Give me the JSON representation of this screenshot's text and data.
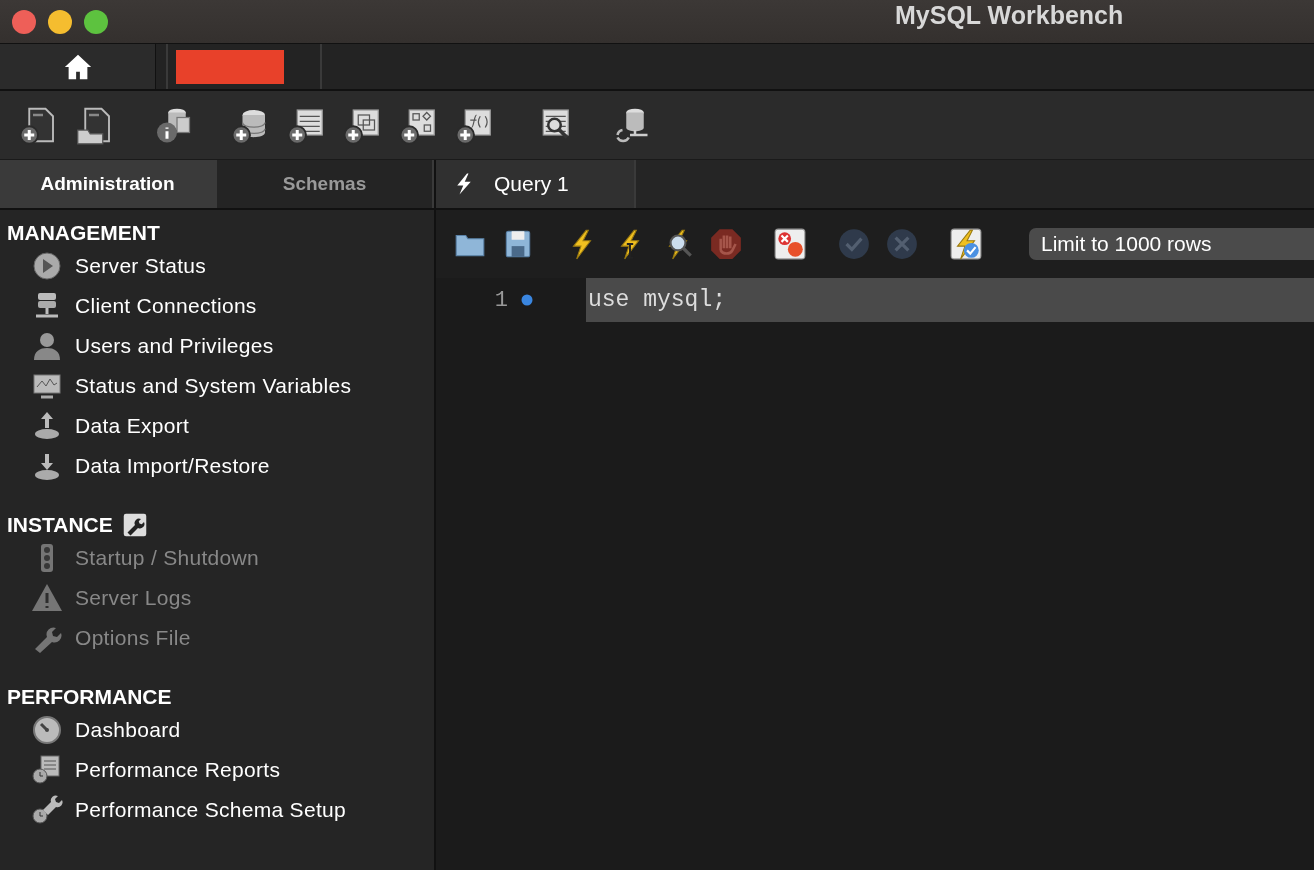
{
  "window": {
    "title": "MySQL Workbench"
  },
  "connection_tabs": [
    {
      "kind": "home"
    },
    {
      "kind": "connection"
    }
  ],
  "toolbar": {
    "groups": [
      [
        {
          "kind": "new-sql"
        },
        {
          "kind": "open-sql"
        }
      ],
      [
        {
          "kind": "inspect"
        }
      ],
      [
        {
          "kind": "new-schema"
        },
        {
          "kind": "new-table"
        },
        {
          "kind": "new-view"
        },
        {
          "kind": "new-procedure"
        },
        {
          "kind": "new-function"
        }
      ],
      [
        {
          "kind": "search-table"
        }
      ],
      [
        {
          "kind": "reconnect"
        }
      ]
    ]
  },
  "sidebar": {
    "tabs": [
      {
        "label": "Administration",
        "selected": true
      },
      {
        "label": "Schemas",
        "selected": false
      }
    ],
    "sections": [
      {
        "title": "MANAGEMENT",
        "tool_icon": false,
        "items": [
          {
            "label": "Server Status",
            "kind": "play",
            "disabled": false
          },
          {
            "label": "Client Connections",
            "kind": "server",
            "disabled": false
          },
          {
            "label": "Users and Privileges",
            "kind": "user",
            "disabled": false
          },
          {
            "label": "Status and System Variables",
            "kind": "monitor",
            "disabled": false
          },
          {
            "label": "Data Export",
            "kind": "export",
            "disabled": false
          },
          {
            "label": "Data Import/Restore",
            "kind": "import",
            "disabled": false
          }
        ]
      },
      {
        "title": "INSTANCE",
        "tool_icon": true,
        "items": [
          {
            "label": "Startup / Shutdown",
            "kind": "traffic",
            "disabled": true
          },
          {
            "label": "Server Logs",
            "kind": "warning",
            "disabled": true
          },
          {
            "label": "Options File",
            "kind": "wrench",
            "disabled": true
          }
        ]
      },
      {
        "title": "PERFORMANCE",
        "tool_icon": false,
        "items": [
          {
            "label": "Dashboard",
            "kind": "gauge",
            "disabled": false
          },
          {
            "label": "Performance Reports",
            "kind": "reports",
            "disabled": false
          },
          {
            "label": "Performance Schema Setup",
            "kind": "setup",
            "disabled": false
          }
        ]
      }
    ]
  },
  "query_tabs": [
    {
      "label": "Query 1",
      "selected": true
    }
  ],
  "editor_toolbar": {
    "groups": [
      [
        {
          "kind": "folder",
          "disabled": false
        },
        {
          "kind": "save",
          "disabled": false
        }
      ],
      [
        {
          "kind": "bolt",
          "disabled": false
        },
        {
          "kind": "bolt-cursor",
          "disabled": false
        },
        {
          "kind": "bolt-search",
          "disabled": false
        },
        {
          "kind": "stop",
          "disabled": false
        }
      ],
      [
        {
          "kind": "stop-on-error",
          "disabled": false
        }
      ],
      [
        {
          "kind": "commit",
          "disabled": true
        },
        {
          "kind": "rollback",
          "disabled": true
        }
      ],
      [
        {
          "kind": "autocommit",
          "disabled": false
        }
      ]
    ]
  },
  "limit_select": {
    "value": "Limit to 1000 rows"
  },
  "editor": {
    "lines": [
      {
        "number": "1",
        "marker": true,
        "current": true,
        "code": "use mysql;"
      }
    ]
  }
}
